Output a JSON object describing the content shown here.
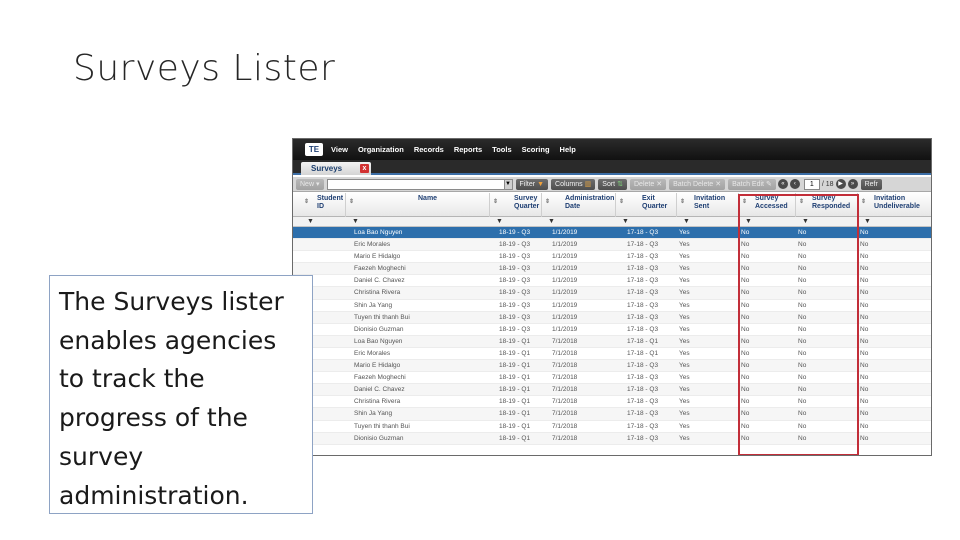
{
  "slide": {
    "title": "Surveys Lister",
    "caption": "The Surveys lister enables agencies to track the progress of the survey administration."
  },
  "app": {
    "logo": "TE",
    "menu": [
      "View",
      "Organization",
      "Records",
      "Reports",
      "Tools",
      "Scoring",
      "Help"
    ],
    "tab": {
      "label": "Surveys",
      "close": "x"
    },
    "toolbar": {
      "new": "New",
      "filter": "Filter",
      "columns": "Columns",
      "sort": "Sort",
      "delete": "Delete",
      "batch_delete": "Batch Delete",
      "batch_edit": "Batch Edit",
      "page": "1",
      "of_pages": "/ 18",
      "refresh": "Refr"
    },
    "colors": {
      "selected_row": "#2d6fac",
      "highlight": "#c22e39",
      "menubar": "#1b1b1b",
      "header_text": "#1f3f73"
    },
    "table": {
      "columns": [
        {
          "key": "sid",
          "label": "Student ID"
        },
        {
          "key": "name",
          "label": "Name"
        },
        {
          "key": "sq",
          "label": "Survey Quarter"
        },
        {
          "key": "ad",
          "label": "Administration Date"
        },
        {
          "key": "eq",
          "label": "Exit Quarter"
        },
        {
          "key": "is",
          "label": "Invitation Sent"
        },
        {
          "key": "sa",
          "label": "Survey Accessed"
        },
        {
          "key": "sr",
          "label": "Survey Responded"
        },
        {
          "key": "iu",
          "label": "Invitation Undeliverable"
        }
      ],
      "rows": [
        {
          "sid": "",
          "name": "Loa Bao Nguyen",
          "sq": "18-19 - Q3",
          "ad": "1/1/2019",
          "eq": "17-18 - Q3",
          "is": "Yes",
          "sa": "No",
          "sr": "No",
          "iu": "No",
          "selected": true
        },
        {
          "sid": "",
          "name": "Eric Morales",
          "sq": "18-19 - Q3",
          "ad": "1/1/2019",
          "eq": "17-18 - Q3",
          "is": "Yes",
          "sa": "No",
          "sr": "No",
          "iu": "No"
        },
        {
          "sid": "",
          "name": "Mario E Hidalgo",
          "sq": "18-19 - Q3",
          "ad": "1/1/2019",
          "eq": "17-18 - Q3",
          "is": "Yes",
          "sa": "No",
          "sr": "No",
          "iu": "No"
        },
        {
          "sid": "",
          "name": "Faezeh Moghechi",
          "sq": "18-19 - Q3",
          "ad": "1/1/2019",
          "eq": "17-18 - Q3",
          "is": "Yes",
          "sa": "No",
          "sr": "No",
          "iu": "No"
        },
        {
          "sid": "",
          "name": "Daniel C. Chavez",
          "sq": "18-19 - Q3",
          "ad": "1/1/2019",
          "eq": "17-18 - Q3",
          "is": "Yes",
          "sa": "No",
          "sr": "No",
          "iu": "No"
        },
        {
          "sid": "",
          "name": "Christina Rivera",
          "sq": "18-19 - Q3",
          "ad": "1/1/2019",
          "eq": "17-18 - Q3",
          "is": "Yes",
          "sa": "No",
          "sr": "No",
          "iu": "No"
        },
        {
          "sid": "",
          "name": "Shin Ja Yang",
          "sq": "18-19 - Q3",
          "ad": "1/1/2019",
          "eq": "17-18 - Q3",
          "is": "Yes",
          "sa": "No",
          "sr": "No",
          "iu": "No"
        },
        {
          "sid": "",
          "name": "Tuyen thi thanh Bui",
          "sq": "18-19 - Q3",
          "ad": "1/1/2019",
          "eq": "17-18 - Q3",
          "is": "Yes",
          "sa": "No",
          "sr": "No",
          "iu": "No"
        },
        {
          "sid": "",
          "name": "Dionisio Guzman",
          "sq": "18-19 - Q3",
          "ad": "1/1/2019",
          "eq": "17-18 - Q3",
          "is": "Yes",
          "sa": "No",
          "sr": "No",
          "iu": "No"
        },
        {
          "sid": "",
          "name": "Loa Bao Nguyen",
          "sq": "18-19 - Q1",
          "ad": "7/1/2018",
          "eq": "17-18 - Q1",
          "is": "Yes",
          "sa": "No",
          "sr": "No",
          "iu": "No"
        },
        {
          "sid": "",
          "name": "Eric Morales",
          "sq": "18-19 - Q1",
          "ad": "7/1/2018",
          "eq": "17-18 - Q1",
          "is": "Yes",
          "sa": "No",
          "sr": "No",
          "iu": "No"
        },
        {
          "sid": "",
          "name": "Mario E Hidalgo",
          "sq": "18-19 - Q1",
          "ad": "7/1/2018",
          "eq": "17-18 - Q3",
          "is": "Yes",
          "sa": "No",
          "sr": "No",
          "iu": "No"
        },
        {
          "sid": "",
          "name": "Faezeh Moghechi",
          "sq": "18-19 - Q1",
          "ad": "7/1/2018",
          "eq": "17-18 - Q3",
          "is": "Yes",
          "sa": "No",
          "sr": "No",
          "iu": "No"
        },
        {
          "sid": "",
          "name": "Daniel C. Chavez",
          "sq": "18-19 - Q1",
          "ad": "7/1/2018",
          "eq": "17-18 - Q3",
          "is": "Yes",
          "sa": "No",
          "sr": "No",
          "iu": "No"
        },
        {
          "sid": "",
          "name": "Christina Rivera",
          "sq": "18-19 - Q1",
          "ad": "7/1/2018",
          "eq": "17-18 - Q3",
          "is": "Yes",
          "sa": "No",
          "sr": "No",
          "iu": "No"
        },
        {
          "sid": "",
          "name": "Shin Ja Yang",
          "sq": "18-19 - Q1",
          "ad": "7/1/2018",
          "eq": "17-18 - Q3",
          "is": "Yes",
          "sa": "No",
          "sr": "No",
          "iu": "No"
        },
        {
          "sid": "",
          "name": "Tuyen thi thanh Bui",
          "sq": "18-19 - Q1",
          "ad": "7/1/2018",
          "eq": "17-18 - Q3",
          "is": "Yes",
          "sa": "No",
          "sr": "No",
          "iu": "No"
        },
        {
          "sid": "",
          "name": "Dionisio Guzman",
          "sq": "18-19 - Q1",
          "ad": "7/1/2018",
          "eq": "17-18 - Q3",
          "is": "Yes",
          "sa": "No",
          "sr": "No",
          "iu": "No"
        }
      ]
    }
  }
}
